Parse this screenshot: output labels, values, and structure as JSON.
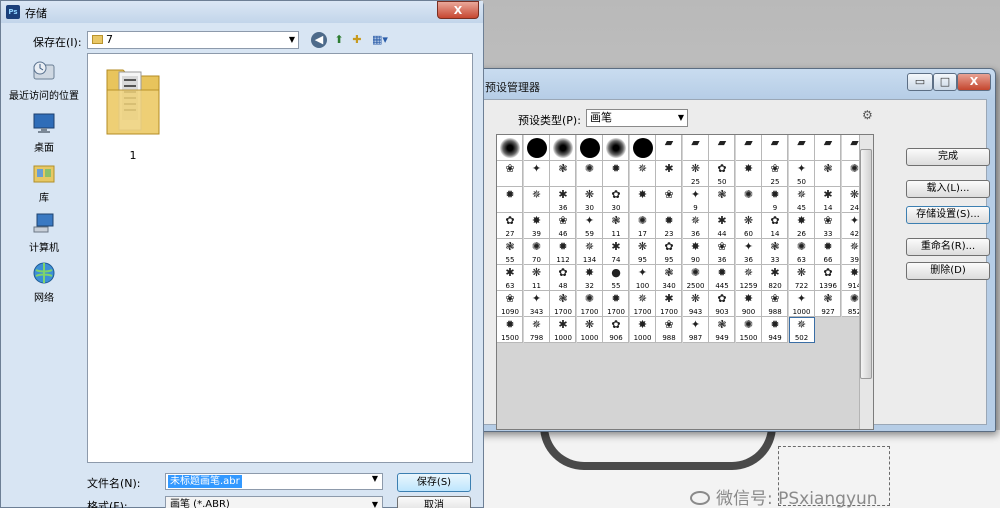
{
  "save_dialog": {
    "title": "存储",
    "save_in_label": "保存在(I):",
    "location": "7",
    "places": [
      "最近访问的位置",
      "桌面",
      "库",
      "计算机",
      "网络"
    ],
    "folder": {
      "name": "1"
    },
    "filename_label": "文件名(N):",
    "filename_value": "未标题画笔.abr",
    "format_label": "格式(F):",
    "format_value": "画笔 (*.ABR)",
    "save_button": "保存(S)",
    "cancel_button": "取消"
  },
  "preset_manager": {
    "title": "预设管理器",
    "title_buttons": [
      "▭",
      "□",
      "X"
    ],
    "preset_type_label": "预设类型(P):",
    "preset_type_value": "画笔",
    "buttons": [
      "完成",
      "载入(L)...",
      "存储设置(S)...",
      "重命名(R)...",
      "删除(D)"
    ],
    "brush_sizes": [
      "",
      "",
      "",
      "",
      "",
      "",
      "",
      "",
      "",
      "",
      "",
      "",
      "",
      "",
      "",
      "",
      "",
      "",
      "",
      "",
      "",
      "25",
      "50",
      "",
      "25",
      "50",
      "",
      "",
      "",
      "",
      "36",
      "30",
      "30",
      "",
      "",
      "9",
      "",
      "",
      "9",
      "45",
      "14",
      "24",
      "27",
      "39",
      "46",
      "59",
      "11",
      "17",
      "23",
      "36",
      "44",
      "60",
      "14",
      "26",
      "33",
      "42",
      "55",
      "70",
      "112",
      "134",
      "74",
      "95",
      "95",
      "90",
      "36",
      "36",
      "33",
      "63",
      "66",
      "39",
      "63",
      "11",
      "48",
      "32",
      "55",
      "100",
      "340",
      "2500",
      "445",
      "1259",
      "820",
      "722",
      "1396",
      "914",
      "1090",
      "343",
      "1700",
      "1700",
      "1700",
      "1700",
      "1700",
      "943",
      "903",
      "900",
      "988",
      "1000",
      "927",
      "852",
      "1500",
      "798",
      "1000",
      "1000",
      "906",
      "1000",
      "988",
      "987",
      "949",
      "1500",
      "949",
      "502"
    ],
    "brush_icons": [
      "soft-round",
      "hard-round",
      "soft-round",
      "hard-round",
      "soft-round",
      "hard-round",
      "tip",
      "tip",
      "tip",
      "tip",
      "tip",
      "tip",
      "tip",
      "tip"
    ]
  },
  "watermark": "微信号: PSxiangyun",
  "colors": {
    "accent": "#3399ff",
    "window_frame": "#b6cde6",
    "close": "#c74731"
  }
}
